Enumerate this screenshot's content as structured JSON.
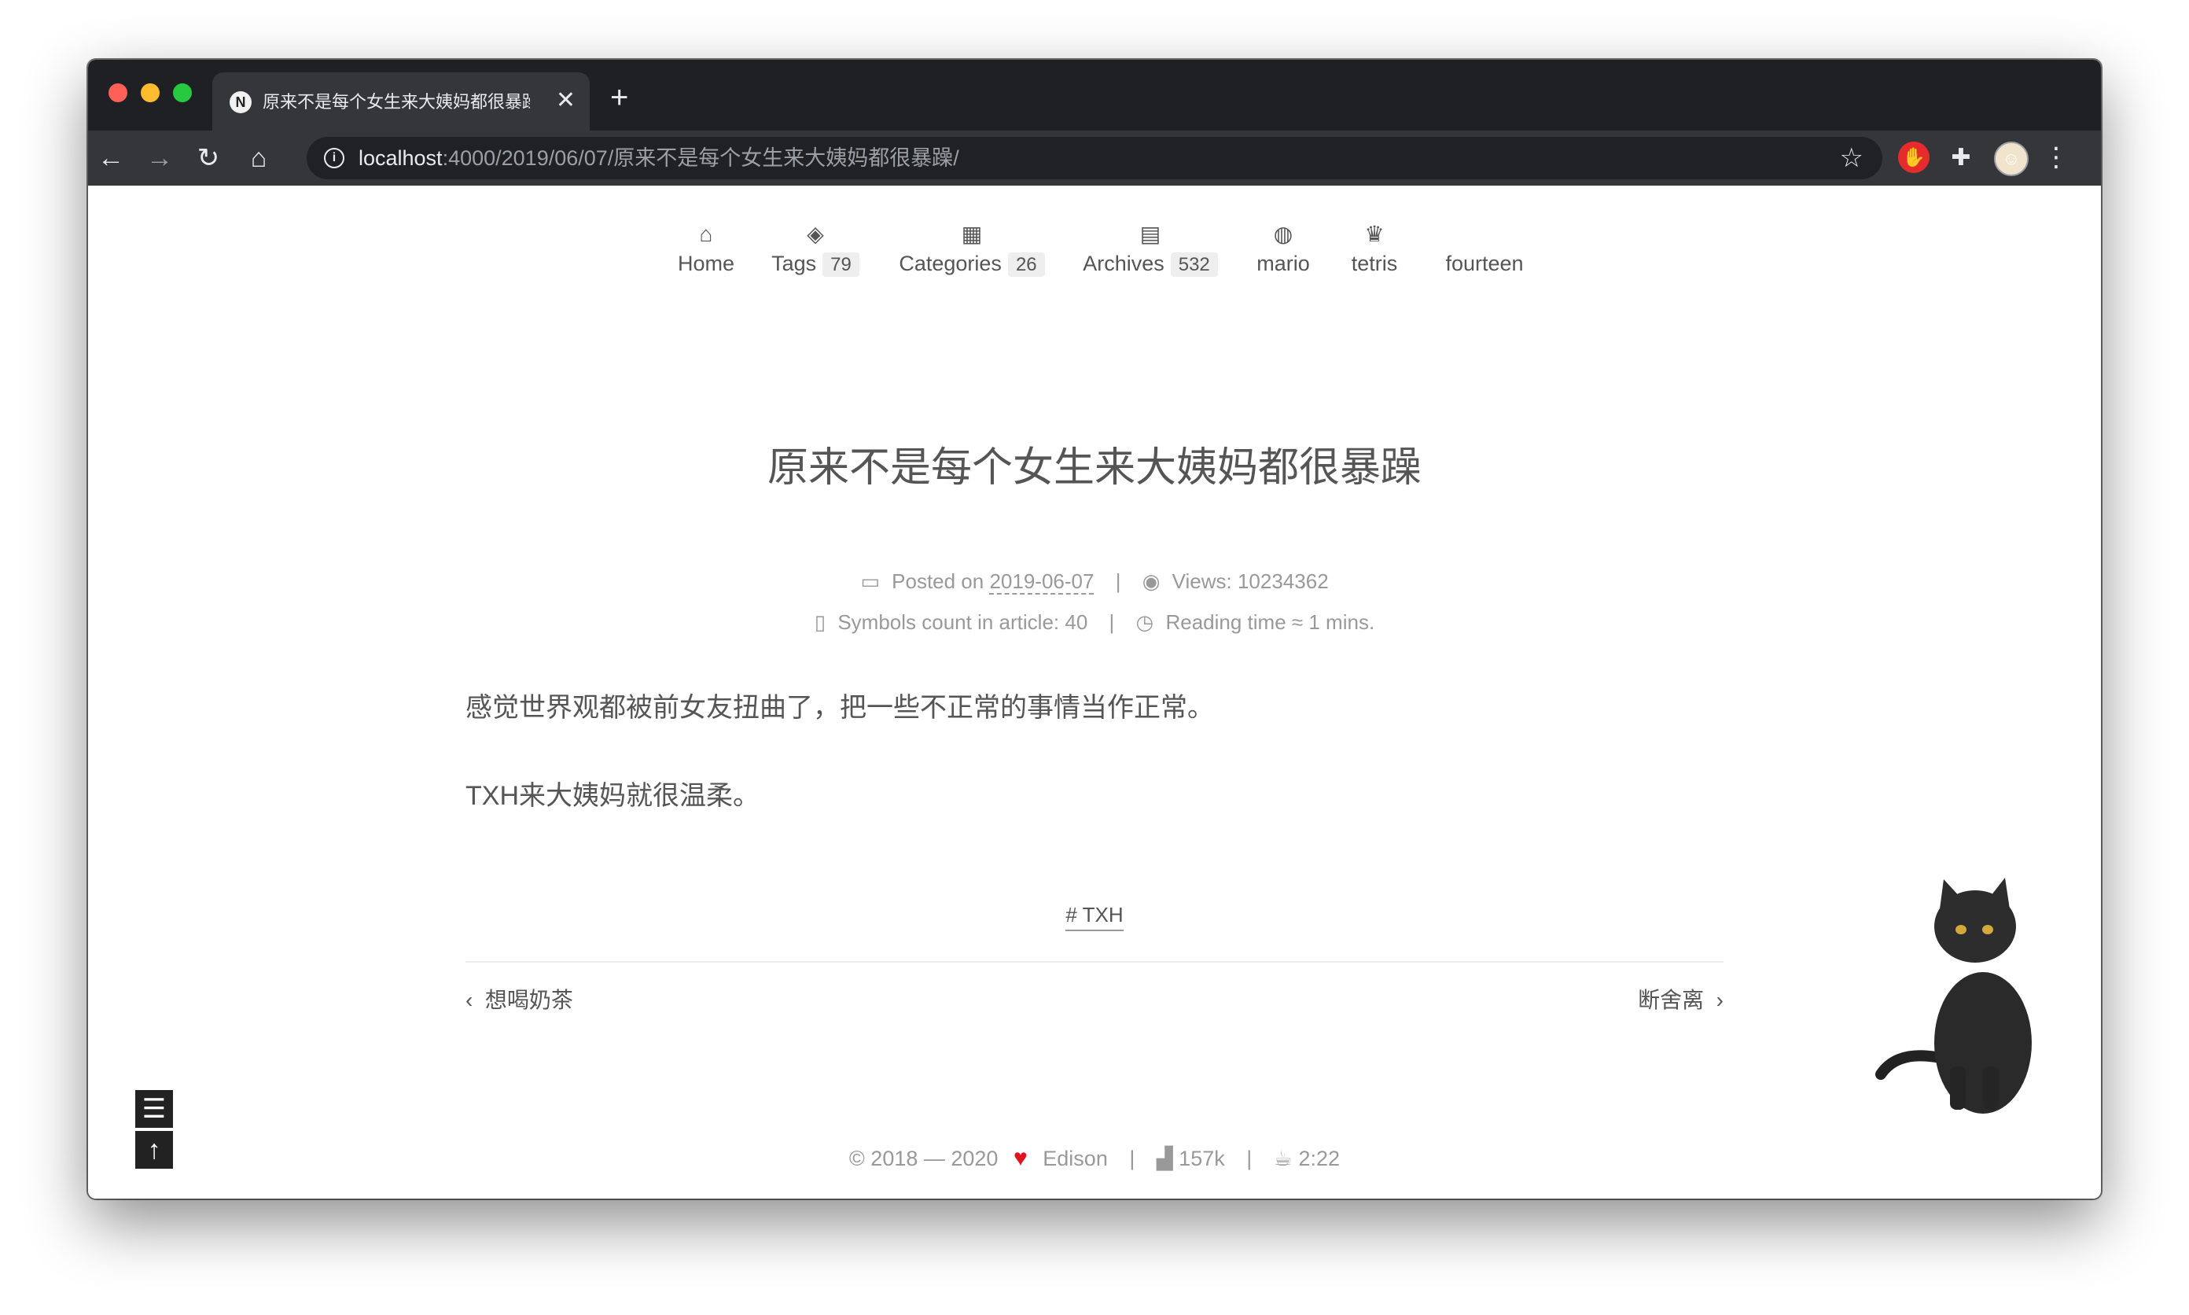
{
  "browser": {
    "tab_title": "原来不是每个女生来大姨妈都很暴躁",
    "tab_favicon": "N",
    "tab_close": "✕",
    "new_tab": "+",
    "url_host": "localhost",
    "url_path": ":4000/2019/06/07/原来不是每个女生来大姨妈都很暴躁/",
    "icons": [
      "back-icon",
      "forward-icon",
      "reload-icon",
      "home-icon",
      "info-icon",
      "star-icon",
      "stop-extension-icon",
      "extensions-icon",
      "profile-avatar",
      "more-menu-icon"
    ]
  },
  "nav": {
    "items": [
      {
        "label": "Home",
        "icon": "home-icon"
      },
      {
        "label": "Tags",
        "count": "79",
        "icon": "tags-icon"
      },
      {
        "label": "Categories",
        "count": "26",
        "icon": "th-icon"
      },
      {
        "label": "Archives",
        "count": "532",
        "icon": "archive-icon"
      },
      {
        "label": "mario",
        "icon": "gamepad-icon"
      },
      {
        "label": "tetris",
        "icon": "trophy-icon"
      },
      {
        "label": "fourteen",
        "icon": ""
      }
    ]
  },
  "post": {
    "title": "原来不是每个女生来大姨妈都很暴躁",
    "posted_on_label": "Posted on",
    "date": "2019-06-07",
    "views_label": "Views:",
    "views": "10234362",
    "symbols_label": "Symbols count in article:",
    "symbols": "40",
    "reading_label": "Reading time ≈",
    "reading": "1 mins.",
    "paragraphs": [
      "感觉世界观都被前女友扭曲了，把一些不正常的事情当作正常。",
      "TXH来大姨妈就很温柔。"
    ],
    "tag": "# TXH",
    "prev": "想喝奶茶",
    "next": "断舍离"
  },
  "footer": {
    "copyright": "© 2018 — 2020",
    "author": "Edison",
    "word_count": "157k",
    "reading_time": "2:22"
  },
  "colors": {
    "text": "#555555",
    "meta": "#999999",
    "heart": "#e0141e",
    "chrome_dark": "#1f2023",
    "chrome_toolbar": "#35363a"
  }
}
